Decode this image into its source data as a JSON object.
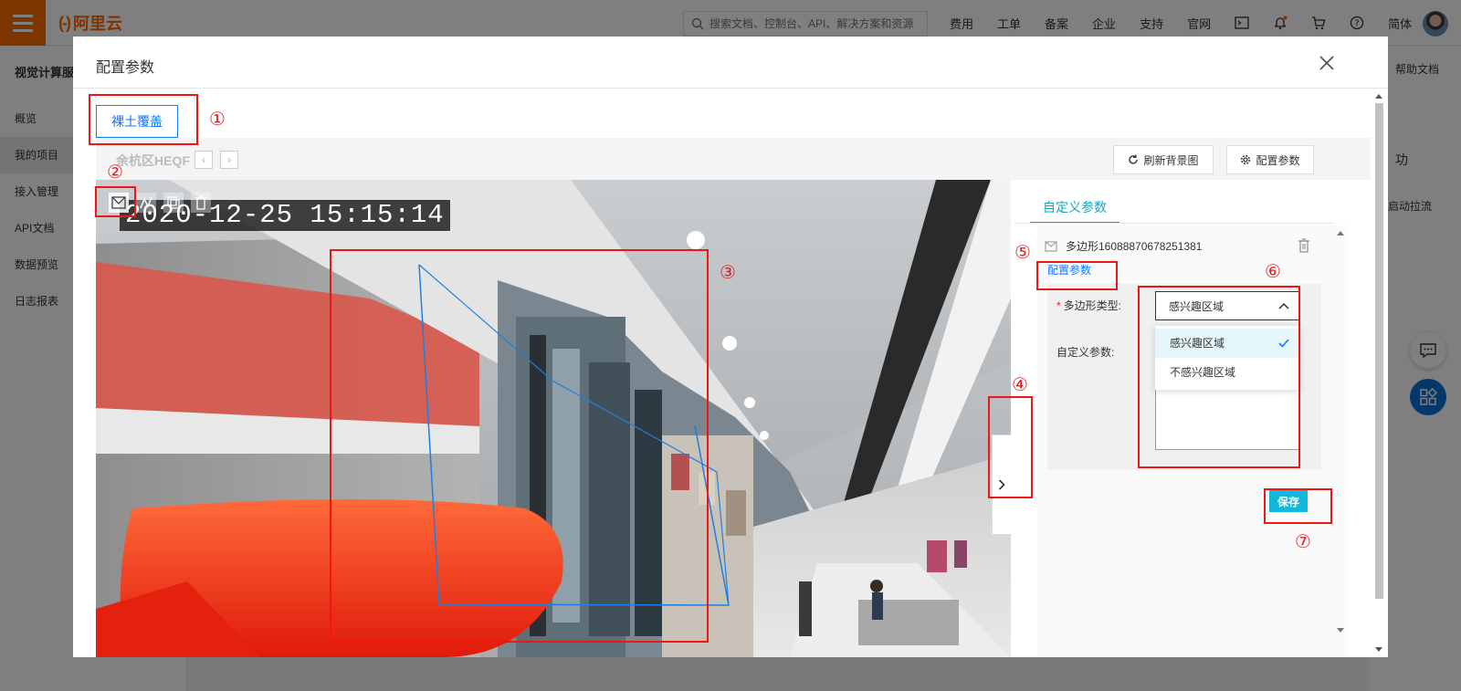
{
  "app": {
    "logo_text": "阿里云",
    "search": {
      "placeholder": "搜索文档、控制台、API、解决方案和资源"
    },
    "nav": [
      "费用",
      "工单",
      "备案",
      "企业",
      "支持",
      "官网"
    ],
    "lang": "简体",
    "sidebar": {
      "title": "视觉计算服",
      "items": [
        "概览",
        "我的项目",
        "接入管理",
        "API文档",
        "数据预览",
        "日志报表"
      ],
      "active_index": 1
    },
    "right_panel": {
      "help": "帮助文档",
      "status": "功",
      "pull": "启动拉流"
    }
  },
  "modal": {
    "title": "配置参数",
    "scene_button": "裸土覆盖",
    "toolbar": {
      "camera_name": "余杭区HEQF",
      "refresh_button": "刷新背景图",
      "config_button": "配置参数"
    },
    "camera": {
      "timestamp": "2020-12-25 15:15:14",
      "tools": [
        "polygon-tool",
        "line-tool",
        "copy-tool",
        "delete-tool"
      ]
    },
    "panel": {
      "tab": "自定义参数",
      "polygon_name": "多边形16088870678251381",
      "config_link": "配置参数",
      "polygon_type_label": "多边形类型:",
      "custom_params_label": "自定义参数:",
      "selected_type": "感兴趣区域",
      "options": [
        "感兴趣区域",
        "不感兴趣区域"
      ],
      "save_button": "保存"
    }
  },
  "annotations": [
    "①",
    "②",
    "③",
    "④",
    "⑤",
    "⑥",
    "⑦"
  ],
  "colors": {
    "brand": "#ff6a00",
    "accent": "#12a6c4",
    "link": "#1677ff",
    "highlight": "#f01616",
    "polygon": "#1e7fe0"
  }
}
